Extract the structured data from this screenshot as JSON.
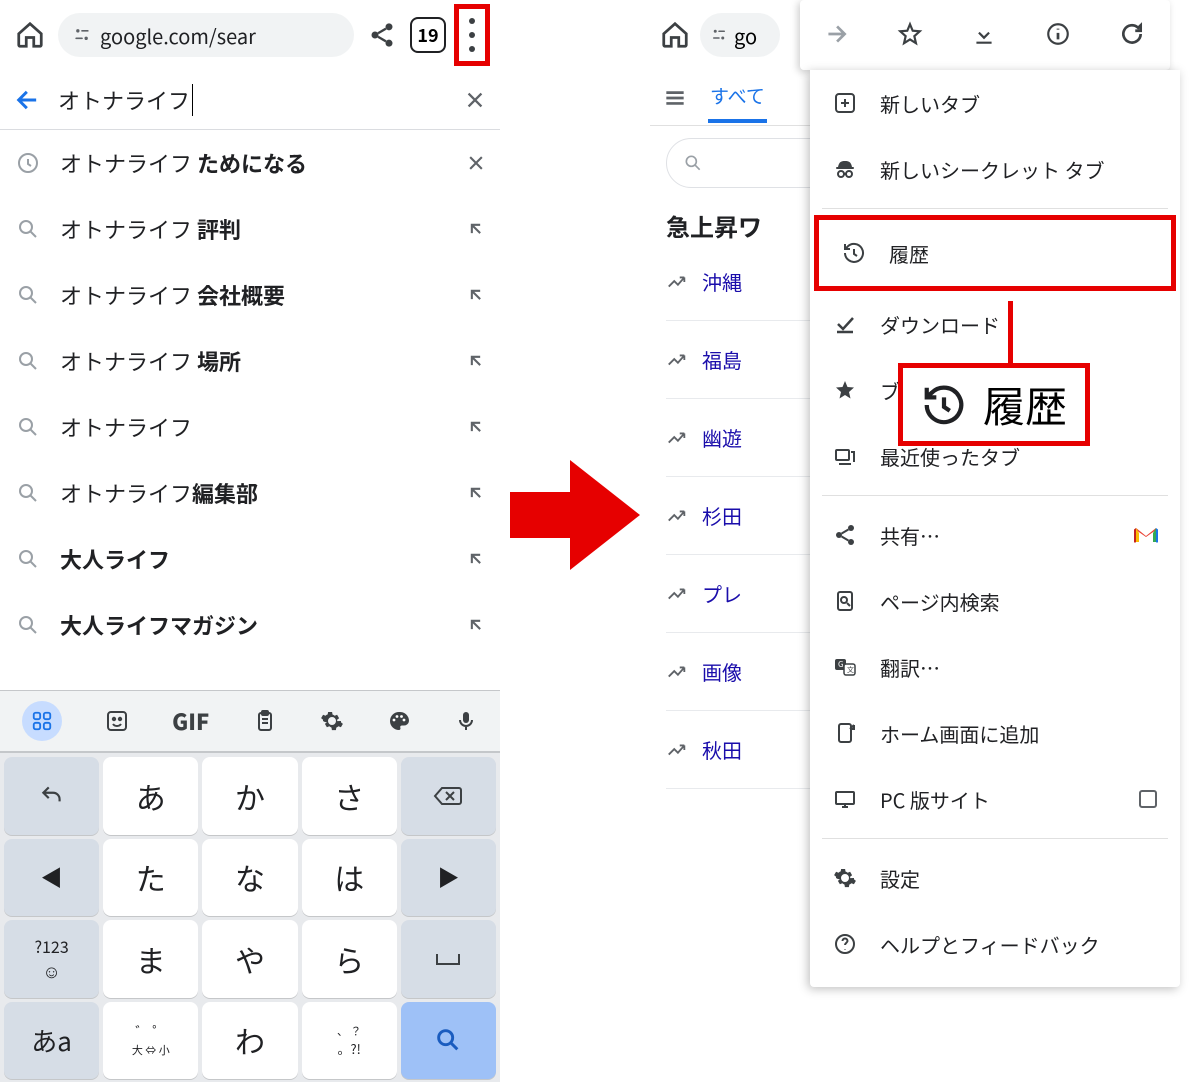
{
  "left": {
    "url": "google.com/sear",
    "tab_count": "19",
    "query": "オトナライフ",
    "suggestions": [
      {
        "prefix": "オトナライフ ",
        "bold": "ためになる",
        "lead": "history",
        "trail": "close"
      },
      {
        "prefix": "オトナライフ ",
        "bold": "評判",
        "lead": "search",
        "trail": "arrow"
      },
      {
        "prefix": "オトナライフ ",
        "bold": "会社概要",
        "lead": "search",
        "trail": "arrow"
      },
      {
        "prefix": "オトナライフ ",
        "bold": "場所",
        "lead": "search",
        "trail": "arrow"
      },
      {
        "prefix": "オトナライフ",
        "bold": "",
        "lead": "search",
        "trail": "arrow"
      },
      {
        "prefix": "オトナライフ",
        "bold": "編集部",
        "lead": "search",
        "trail": "arrow"
      },
      {
        "prefix": "",
        "bold": "大人ライフ",
        "lead": "search",
        "trail": "arrow"
      },
      {
        "prefix": "",
        "bold": "大人ライフマガジン",
        "lead": "search",
        "trail": "arrow"
      }
    ],
    "kbd_top_gif": "GIF",
    "keys": {
      "r1c2": "あ",
      "r1c3": "か",
      "r1c4": "さ",
      "r2c2": "た",
      "r2c3": "な",
      "r2c4": "は",
      "r3c1": "?123",
      "r3c2": "ま",
      "r3c3": "や",
      "r3c4": "ら",
      "r4c1": "あa",
      "r4c2_sub": "大 ⇔ 小",
      "r4c3": "わ",
      "r4c4_sub": "。?!"
    }
  },
  "right": {
    "url": "go",
    "tab_active": "すべて",
    "menu": {
      "new_tab": "新しいタブ",
      "incognito": "新しいシークレット タブ",
      "history": "履歴",
      "downloads": "ダウンロード",
      "bookmarks": "ブッ",
      "recent": "最近使ったタブ",
      "share": "共有…",
      "find": "ページ内検索",
      "translate": "翻訳…",
      "add_home": "ホーム画面に追加",
      "desktop": "PC 版サイト",
      "settings": "設定",
      "help": "ヘルプとフィードバック"
    },
    "callout": "履歴",
    "bg_heading": "急上昇ワ",
    "trends": [
      "沖縄",
      "福島",
      "幽遊",
      "杉田",
      "プレ",
      "画像",
      "秋田"
    ]
  }
}
